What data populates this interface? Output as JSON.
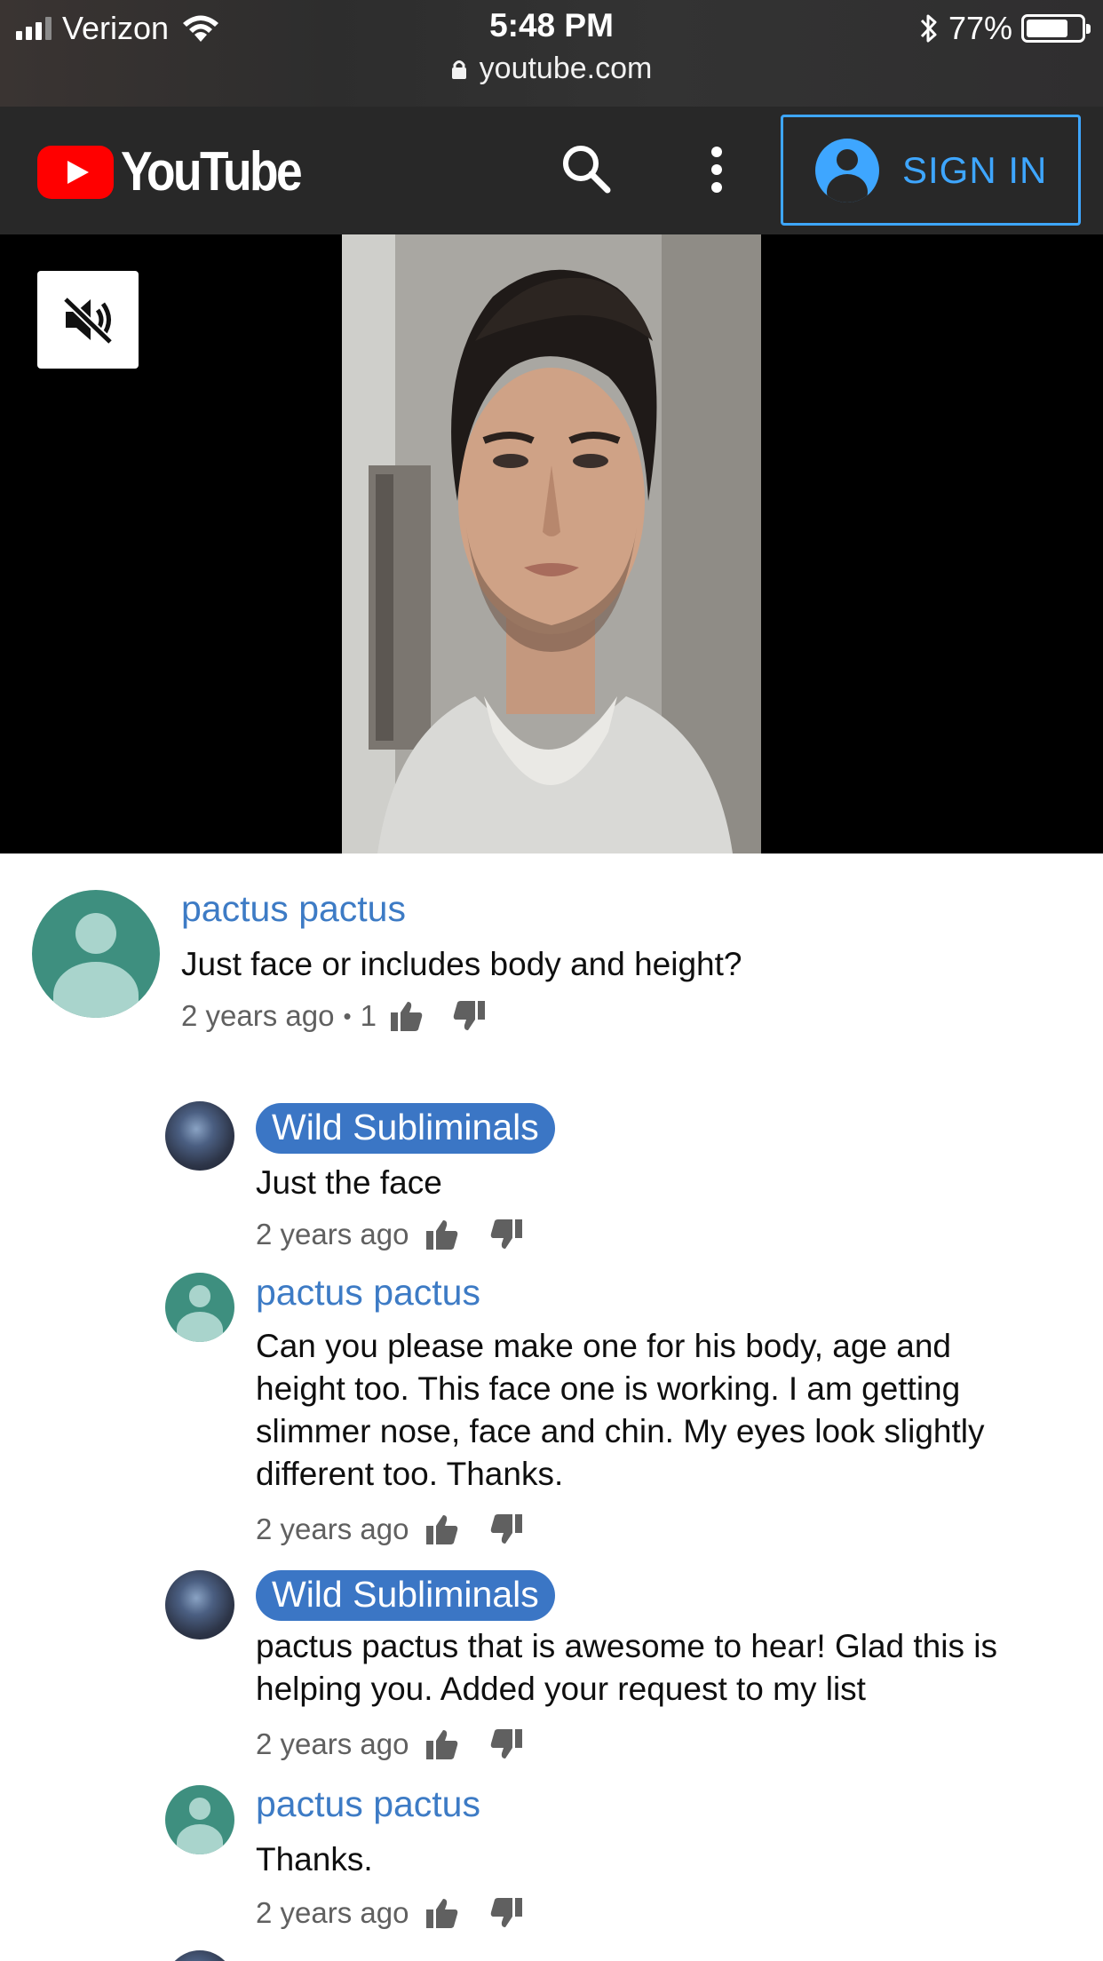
{
  "status_bar": {
    "carrier": "Verizon",
    "time": "5:48 PM",
    "battery": "77%",
    "battery_level": 0.77,
    "url": "youtube.com"
  },
  "header": {
    "logo_text": "YouTube",
    "signin_label": "SIGN IN"
  },
  "colors": {
    "accent_blue": "#3ea6ff",
    "brand_red": "#ff0000",
    "author_blue": "#3d7bc5",
    "badge_blue": "#3b76c5",
    "avatar_teal": "#3e8f7f"
  },
  "comments": [
    {
      "author": "pactus pactus",
      "text": "Just face or includes body and height?",
      "time": "2 years ago",
      "separator": "•",
      "likes": "1"
    },
    {
      "author": "Wild Subliminals",
      "text": "Just the face",
      "time": "2 years ago"
    },
    {
      "author": "pactus pactus",
      "text_lines": [
        "Can you please make one for his body, age and",
        "height too. This face one is working. I am getting",
        "slimmer nose, face and chin. My eyes look slightly",
        "different too. Thanks."
      ],
      "time": "2 years ago"
    },
    {
      "author": "Wild Subliminals",
      "text_lines": [
        "pactus pactus that is awesome to hear! Glad this is",
        "helping you. Added your request to my list"
      ],
      "time": "2 years ago"
    },
    {
      "author": "pactus pactus",
      "text": "Thanks.",
      "time": "2 years ago"
    }
  ]
}
